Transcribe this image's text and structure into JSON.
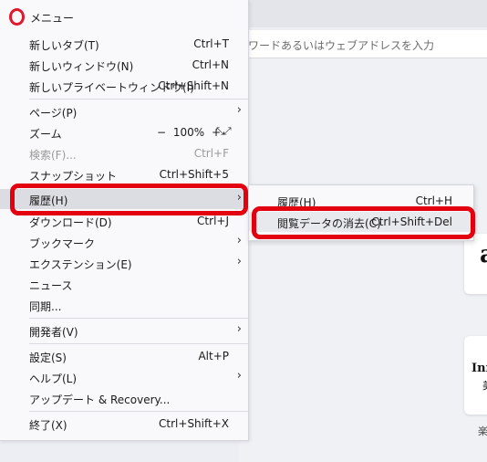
{
  "menu": {
    "title": "メニュー",
    "items": [
      {
        "label": "新しいタブ(T)",
        "shortcut": "Ctrl+T"
      },
      {
        "label": "新しいウィンドウ(N)",
        "shortcut": "Ctrl+N"
      },
      {
        "label": "新しいプライベートウィンドウ(I)",
        "shortcut": "Ctrl+Shift+N"
      },
      {
        "label": "ページ(P)"
      },
      {
        "label": "ズーム",
        "zoom_minus": "−",
        "zoom_value": "100%",
        "zoom_plus": "+",
        "fullscreen_glyph": "⤡⤢"
      },
      {
        "label": "検索(F)...",
        "shortcut": "Ctrl+F"
      },
      {
        "label": "スナップショット",
        "shortcut": "Ctrl+Shift+5"
      },
      {
        "label": "履歴(H)"
      },
      {
        "label": "ダウンロード(D)",
        "shortcut": "Ctrl+J"
      },
      {
        "label": "ブックマーク"
      },
      {
        "label": "エクステンション(E)"
      },
      {
        "label": "ニュース"
      },
      {
        "label": "同期..."
      },
      {
        "label": "開発者(V)"
      },
      {
        "label": "設定(S)",
        "shortcut": "Alt+P"
      },
      {
        "label": "ヘルプ(L)"
      },
      {
        "label": "アップデート & Recovery..."
      },
      {
        "label": "終了(X)",
        "shortcut": "Ctrl+Shift+X"
      }
    ],
    "arrow": "›"
  },
  "submenu": {
    "items": [
      {
        "label": "履歴(H)",
        "shortcut": "Ctrl+H"
      },
      {
        "label": "閲覧データの消去(C)",
        "shortcut": "Ctrl+Shift+Del"
      }
    ]
  },
  "background": {
    "address_placeholder": "ワードあるいはウェブアドレスを入力",
    "tile1_text": "a",
    "tile2_text1": "Inf",
    "tile2_text2": "美",
    "tile2_caption": "楽"
  },
  "colors": {
    "annotation": "#e3000f",
    "opera_red": "#e0182d",
    "highlight": "#dcdde2"
  }
}
